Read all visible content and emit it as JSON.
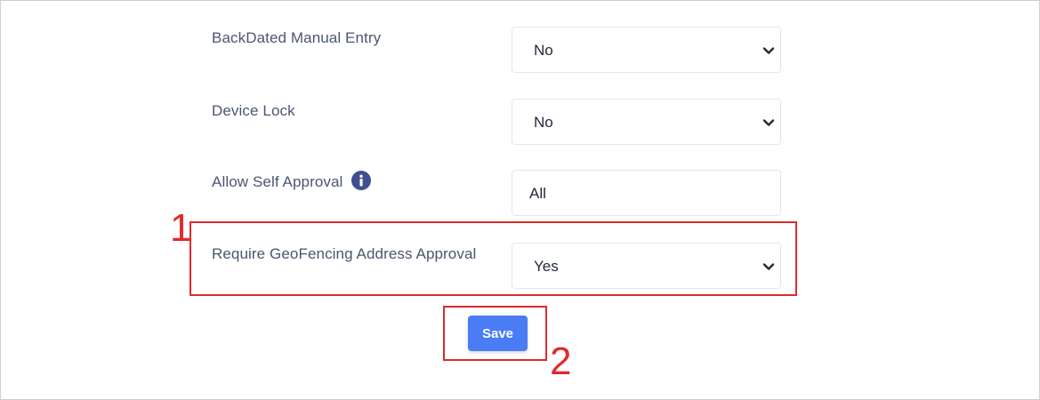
{
  "settings": {
    "rows": [
      {
        "label": "BackDated Manual Entry",
        "value": "No",
        "control": "select"
      },
      {
        "label": "Device Lock",
        "value": "No",
        "control": "select"
      },
      {
        "label": "Allow Self Approval",
        "value": "All",
        "control": "input"
      },
      {
        "label": "Require GeoFencing Address Approval",
        "value": "Yes",
        "control": "select"
      }
    ]
  },
  "actions": {
    "save_label": "Save"
  },
  "annotations": {
    "step1": "1",
    "step2": "2",
    "color": "#e02a2a"
  },
  "icons": {
    "info": "info-circle-icon",
    "dropdown": "chevron-down-icon"
  },
  "colors": {
    "label_text": "#4a5672",
    "value_text": "#222b3a",
    "button_bg": "#4a7cf6",
    "info_icon_bg": "#3f4f8f"
  }
}
